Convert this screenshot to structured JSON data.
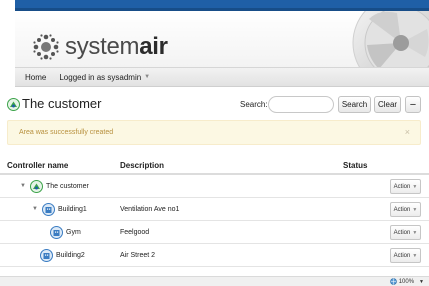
{
  "brand": {
    "name_part1": "system",
    "name_part2": "air"
  },
  "nav": {
    "home": "Home",
    "logged_in": "Logged in as sysadmin"
  },
  "page": {
    "title": "The customer"
  },
  "search": {
    "label": "Search:",
    "placeholder": "",
    "value": ""
  },
  "buttons": {
    "search": "Search",
    "clear": "Clear",
    "collapse": "−"
  },
  "alert": {
    "message": "Area was successfully created",
    "close": "×"
  },
  "table": {
    "columns": {
      "name": "Controller name",
      "description": "Description",
      "status": "Status"
    },
    "rows": [
      {
        "name": "The customer",
        "description": "",
        "status": "",
        "action": "Action",
        "level": 0,
        "icon": "customer-icon"
      },
      {
        "name": "Building1",
        "description": "Ventilation Ave no1",
        "status": "",
        "action": "Action",
        "level": 1,
        "icon": "building-icon"
      },
      {
        "name": "Gym",
        "description": "Feelgood",
        "status": "",
        "action": "Action",
        "level": 2,
        "icon": "building-icon"
      },
      {
        "name": "Building2",
        "description": "Air Street 2",
        "status": "",
        "action": "Action",
        "level": 1,
        "icon": "building-icon"
      }
    ]
  },
  "statusbar": {
    "zoom": "100%"
  },
  "colors": {
    "brand_blue": "#1f5fa6",
    "alert_bg": "#fcf8e3",
    "alert_text": "#b8903e",
    "tree_green": "#3ca34a"
  }
}
